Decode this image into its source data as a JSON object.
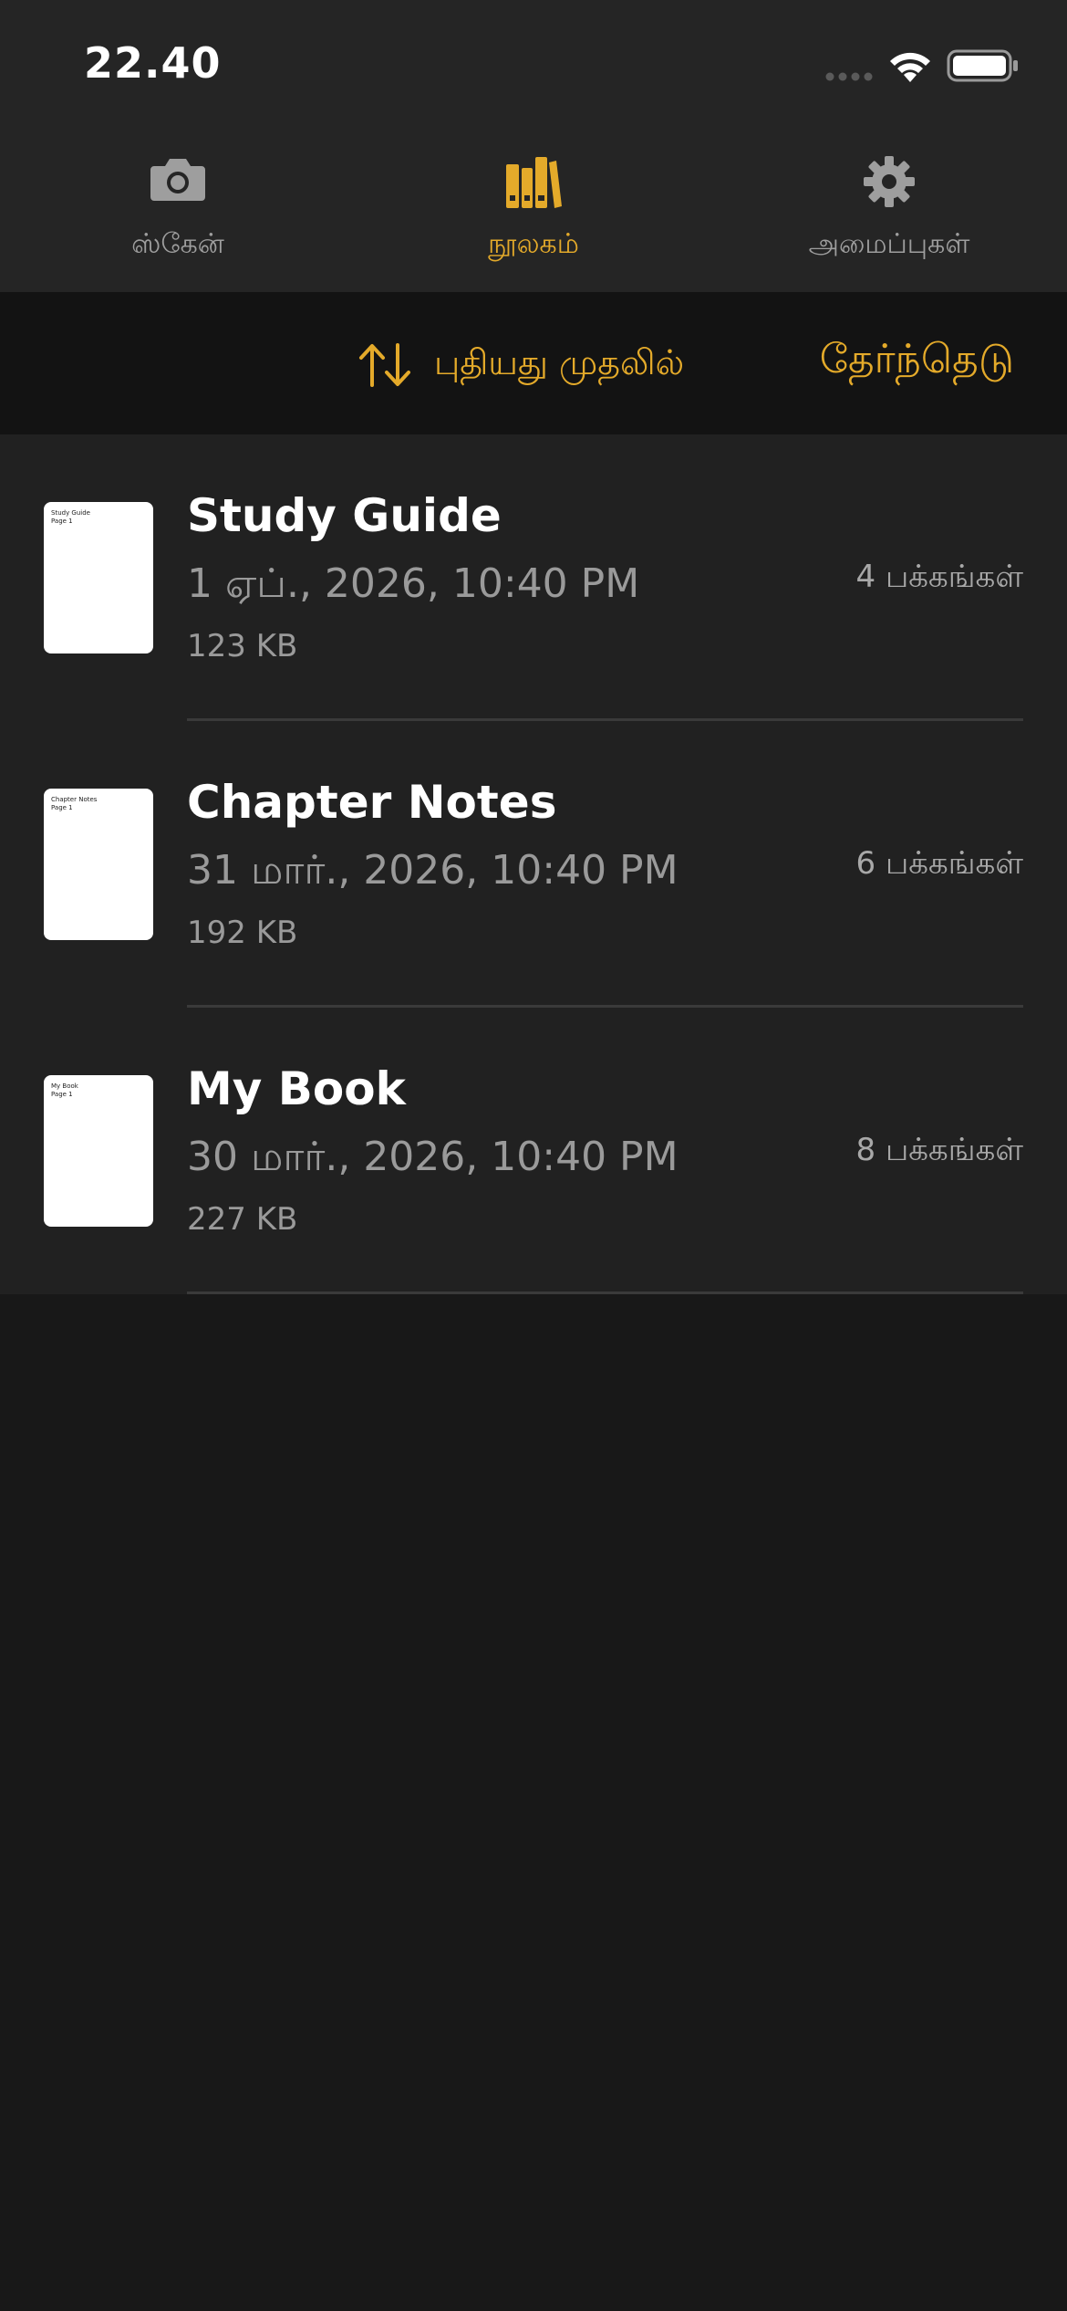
{
  "status_bar": {
    "time": "22.40"
  },
  "tabs": [
    {
      "label": "ஸ்கேன்",
      "icon": "camera-icon",
      "active": false
    },
    {
      "label": "நூலகம்",
      "icon": "books-icon",
      "active": true
    },
    {
      "label": "அமைப்புகள்",
      "icon": "gear-icon",
      "active": false
    }
  ],
  "toolbar": {
    "sort_label": "புதியது முதலில்",
    "sort_icon": "sort-arrows-icon",
    "select_label": "தேர்ந்தெடு"
  },
  "documents": [
    {
      "title": "Study Guide",
      "date": "1 ஏப்., 2026, 10:40 PM",
      "size": "123 KB",
      "pages": "4 பக்கங்கள்",
      "thumb_title": "Study Guide",
      "thumb_page": "Page 1"
    },
    {
      "title": "Chapter Notes",
      "date": "31 மார்., 2026, 10:40 PM",
      "size": "192 KB",
      "pages": "6 பக்கங்கள்",
      "thumb_title": "Chapter Notes",
      "thumb_page": "Page 1"
    },
    {
      "title": "My Book",
      "date": "30 மார்., 2026, 10:40 PM",
      "size": "227 KB",
      "pages": "8 பக்கங்கள்",
      "thumb_title": "My Book",
      "thumb_page": "Page 1"
    }
  ],
  "colors": {
    "accent": "#e4aa2a",
    "background": "#181818",
    "bar": "#252525",
    "list": "#212121"
  }
}
